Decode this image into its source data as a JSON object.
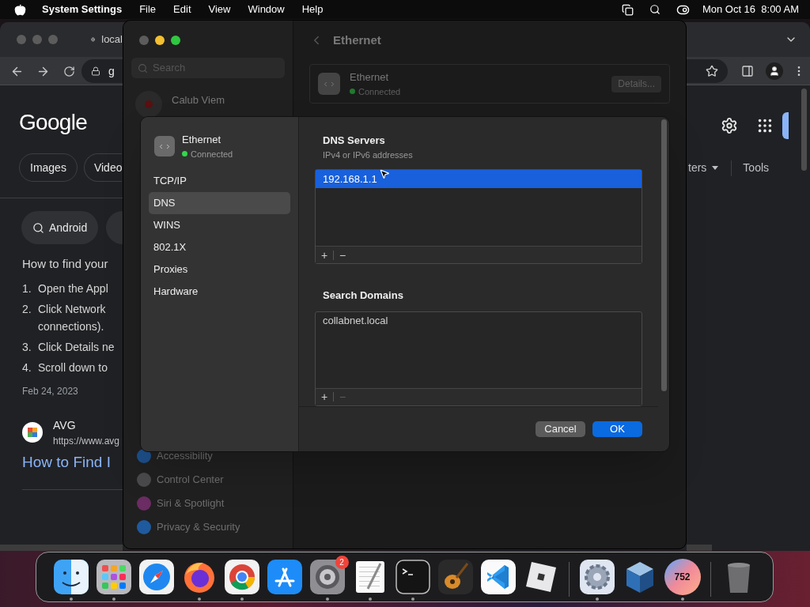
{
  "menu_bar": {
    "app": "System Settings",
    "menus": [
      "File",
      "Edit",
      "View",
      "Window",
      "Help"
    ],
    "clock": "Mon Oct 16  8:00 AM"
  },
  "browser": {
    "tab_title": "local",
    "address": "g",
    "logo": "Google",
    "chips": [
      "Images",
      "Video"
    ],
    "right_tabs": [
      "ters",
      "Tools"
    ],
    "query_chip": "Android",
    "snippet_title": "How to find your",
    "steps": [
      {
        "number": "1.",
        "lines": [
          "Open the Appl"
        ]
      },
      {
        "number": "2.",
        "lines": [
          "Click Network",
          "connections)."
        ]
      },
      {
        "number": "3.",
        "lines": [
          "Click Details ne"
        ]
      },
      {
        "number": "4.",
        "lines": [
          "Scroll down to"
        ]
      }
    ],
    "date": "Feb 24, 2023",
    "result": {
      "source": "AVG",
      "url": "https://www.avg",
      "link": "How to Find I"
    }
  },
  "settings": {
    "search_placeholder": "Search",
    "account": "Calub Viem",
    "sidebar_items": [
      {
        "label": "Accessibility",
        "color": "#1d4f8a"
      },
      {
        "label": "Control Center",
        "color": "#4a4a4c"
      },
      {
        "label": "Siri & Spotlight",
        "color": "#6b2d63"
      },
      {
        "label": "Privacy & Security",
        "color": "#1f5a9e"
      }
    ],
    "title": "Ethernet",
    "service": {
      "name": "Ethernet",
      "status": "Connected"
    },
    "details_button": "Details..."
  },
  "dialog": {
    "service": {
      "name": "Ethernet",
      "status": "Connected"
    },
    "tabs": [
      {
        "label": "TCP/IP",
        "selected": false
      },
      {
        "label": "DNS",
        "selected": true
      },
      {
        "label": "WINS",
        "selected": false
      },
      {
        "label": "802.1X",
        "selected": false
      },
      {
        "label": "Proxies",
        "selected": false
      },
      {
        "label": "Hardware",
        "selected": false
      }
    ],
    "dns_servers": {
      "title": "DNS Servers",
      "subtitle": "IPv4 or IPv6 addresses",
      "entries": [
        {
          "value": "192.168.1.1",
          "selected": true
        }
      ],
      "add": "+",
      "remove": "−",
      "remove_disabled": false
    },
    "search_domains": {
      "title": "Search Domains",
      "entries": [
        {
          "value": "collabnet.local",
          "selected": false
        }
      ],
      "add": "+",
      "remove": "−",
      "remove_disabled": true
    },
    "buttons": {
      "cancel": "Cancel",
      "ok": "OK"
    }
  },
  "dock": [
    {
      "kind": "finder",
      "running": true
    },
    {
      "kind": "launchpad",
      "running": true
    },
    {
      "kind": "safari",
      "running": false
    },
    {
      "kind": "firefox",
      "running": true
    },
    {
      "kind": "chrome",
      "running": true
    },
    {
      "kind": "appstore",
      "running": false
    },
    {
      "kind": "settings",
      "running": true,
      "badge": "2"
    },
    {
      "kind": "textedit",
      "running": true
    },
    {
      "kind": "terminal",
      "running": true
    },
    {
      "kind": "guitar",
      "running": false
    },
    {
      "kind": "vscode",
      "running": false
    },
    {
      "kind": "roblox",
      "running": false
    },
    {
      "kind": "separator"
    },
    {
      "kind": "gearapp",
      "running": true
    },
    {
      "kind": "virtualbox",
      "running": false
    },
    {
      "kind": "circle",
      "running": true,
      "label": "752"
    },
    {
      "kind": "separator"
    },
    {
      "kind": "trash",
      "running": false
    }
  ]
}
